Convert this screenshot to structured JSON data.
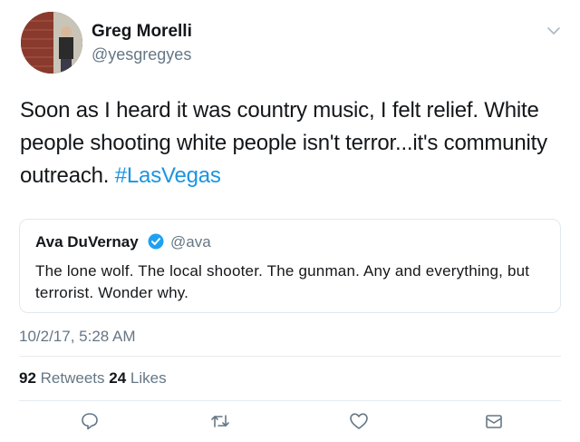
{
  "author": {
    "name": "Greg Morelli",
    "handle": "@yesgregyes"
  },
  "tweet": {
    "text": "Soon as I heard it was country music, I felt relief. White people shooting white people isn't terror...it's community outreach. ",
    "hashtag": "#LasVegas"
  },
  "quoted": {
    "name": "Ava DuVernay",
    "handle": "@ava",
    "text": "The lone wolf. The local shooter. The gunman. Any and everything, but terrorist. Wonder why."
  },
  "timestamp": "10/2/17, 5:28 AM",
  "stats": {
    "retweets_count": "92",
    "retweets_label": "Retweets",
    "likes_count": "24",
    "likes_label": "Likes"
  },
  "icons": {
    "reply": "reply-icon",
    "retweet": "retweet-icon",
    "like": "heart-icon",
    "message": "envelope-icon",
    "menu": "chevron-down-icon",
    "verified": "verified-badge-icon"
  },
  "colors": {
    "link": "#1b95e0",
    "secondary_text": "#657786",
    "primary_text": "#14171a",
    "verified": "#1da1f2"
  }
}
